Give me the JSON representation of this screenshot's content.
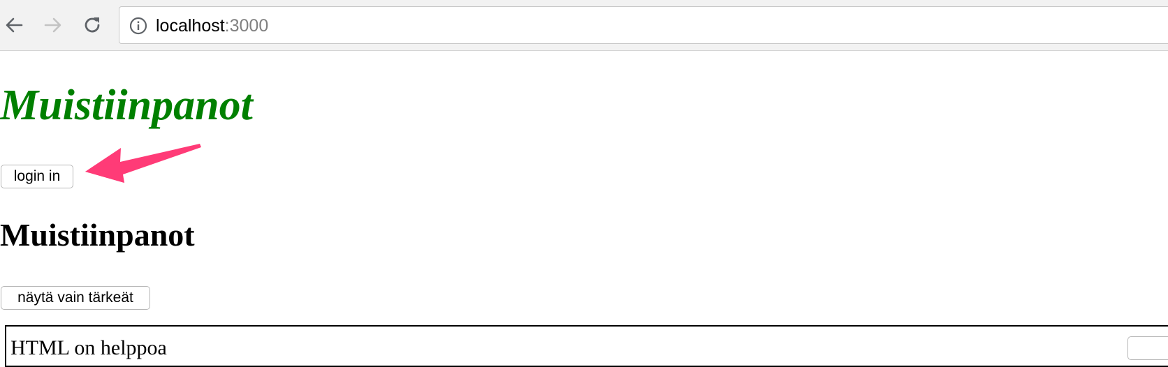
{
  "browser": {
    "url_host": "localhost",
    "url_port": ":3000",
    "icons": [
      "back-arrow-icon",
      "forward-arrow-icon",
      "reload-icon",
      "info-icon"
    ]
  },
  "page": {
    "logo_title": "Muistiinpanot",
    "login_button": "login in",
    "section_title": "Muistiinpanot",
    "show_important_button": "näytä vain tärkeät",
    "notes": [
      {
        "content": "HTML on helppoa"
      }
    ],
    "colors": {
      "logo_title": "#008000",
      "annotation_arrow": "#ff3b77"
    }
  }
}
